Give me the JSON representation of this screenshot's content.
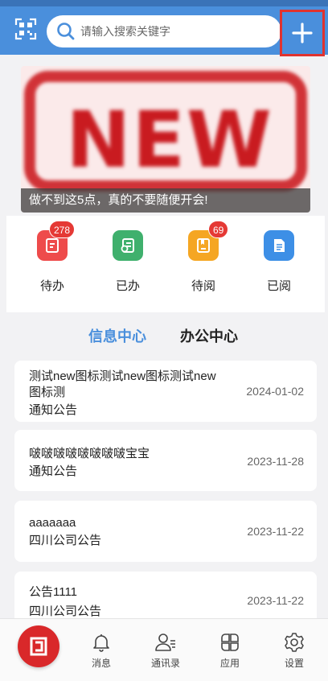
{
  "header": {
    "search_placeholder": "请输入搜索关键字",
    "colors": {
      "bar": "#4a8fdc",
      "accent": "#e0332f"
    },
    "icons": {
      "left": "qr-scan-icon",
      "search": "search-icon",
      "right": "plus-icon"
    }
  },
  "banner": {
    "image_text": "NEW",
    "caption": "做不到这5点，真的不要随便开会!"
  },
  "quick_actions": [
    {
      "label": "待办",
      "badge": "278",
      "icon": "todo-icon",
      "color": "#ee4b4b"
    },
    {
      "label": "已办",
      "badge": "",
      "icon": "done-icon",
      "color": "#3fb06d"
    },
    {
      "label": "待阅",
      "badge": "69",
      "icon": "to-read-icon",
      "color": "#f5a623"
    },
    {
      "label": "已阅",
      "badge": "",
      "icon": "read-icon",
      "color": "#3d8fe6"
    }
  ],
  "tabs": {
    "active": "信息中心",
    "other": "办公中心"
  },
  "notices": [
    {
      "title": "测试new图标测试new图标测试new图标测",
      "category": "通知公告",
      "date": "2024-01-02"
    },
    {
      "title": "啵啵啵啵啵啵啵啵宝宝",
      "category": "通知公告",
      "date": "2023-11-28"
    },
    {
      "title": "aaaaaaa",
      "category": "四川公司公告",
      "date": "2023-11-22"
    },
    {
      "title": "公告1111",
      "category": "四川公司公告",
      "date": "2023-11-22"
    }
  ],
  "bottom_nav": {
    "home_icon": "home-logo-icon",
    "items": [
      {
        "label": "消息",
        "icon": "bell-icon"
      },
      {
        "label": "通讯录",
        "icon": "contacts-icon"
      },
      {
        "label": "应用",
        "icon": "apps-icon"
      },
      {
        "label": "设置",
        "icon": "settings-icon"
      }
    ]
  }
}
